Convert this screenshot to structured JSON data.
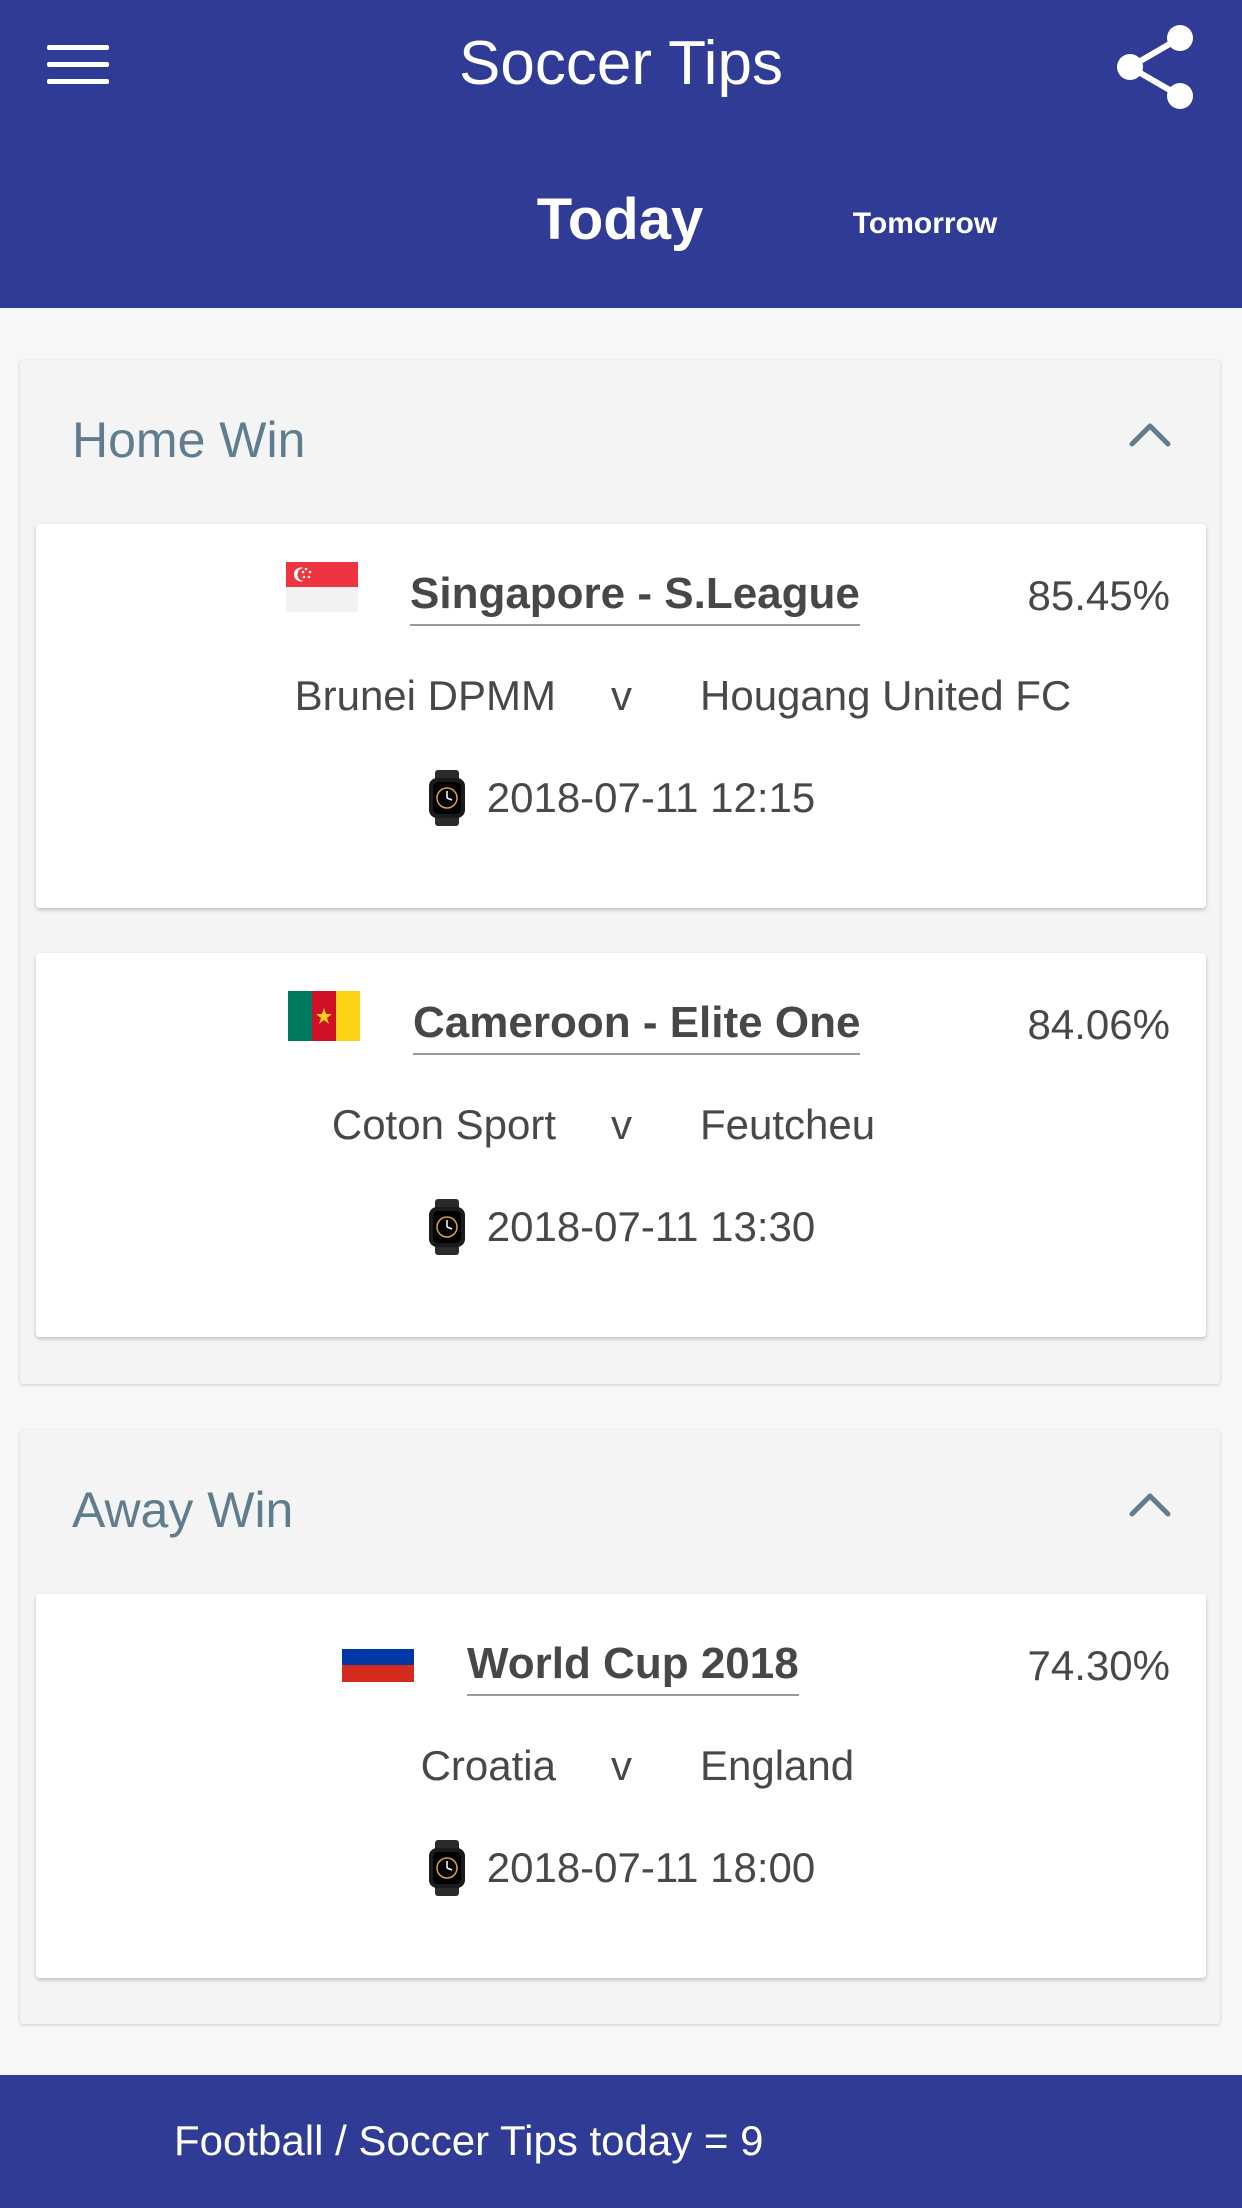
{
  "header": {
    "title": "Soccer Tips",
    "menu_icon": "hamburger-menu-icon",
    "share_icon": "share-icon",
    "background": "#2f3b95"
  },
  "tabs": [
    {
      "label": "Today",
      "selected": true
    },
    {
      "label": "Tomorrow",
      "selected": false
    }
  ],
  "sections": [
    {
      "title": "Home Win",
      "expanded": true,
      "matches": [
        {
          "flag": "singapore-flag-icon",
          "league": "Singapore - S.League",
          "probability": "85.45%",
          "home_team": "Brunei DPMM",
          "versus": "v",
          "away_team": "Hougang United FC",
          "kickoff": "2018-07-11 12:15"
        },
        {
          "flag": "cameroon-flag-icon",
          "league": "Cameroon - Elite One",
          "probability": "84.06%",
          "home_team": "Coton Sport",
          "versus": "v",
          "away_team": "Feutcheu",
          "kickoff": "2018-07-11 13:30"
        }
      ]
    },
    {
      "title": "Away Win",
      "expanded": true,
      "matches": [
        {
          "flag": "russia-flag-icon",
          "league": "World Cup 2018",
          "probability": "74.30%",
          "home_team": "Croatia",
          "versus": "v",
          "away_team": "England",
          "kickoff": "2018-07-11 18:00"
        }
      ]
    }
  ],
  "footer": {
    "text": "Football / Soccer Tips today = 9"
  },
  "colors": {
    "primary": "#2f3b95",
    "section_title": "#5f7d8f",
    "section_background": "#f4f4f4",
    "card_background": "#ffffff"
  }
}
